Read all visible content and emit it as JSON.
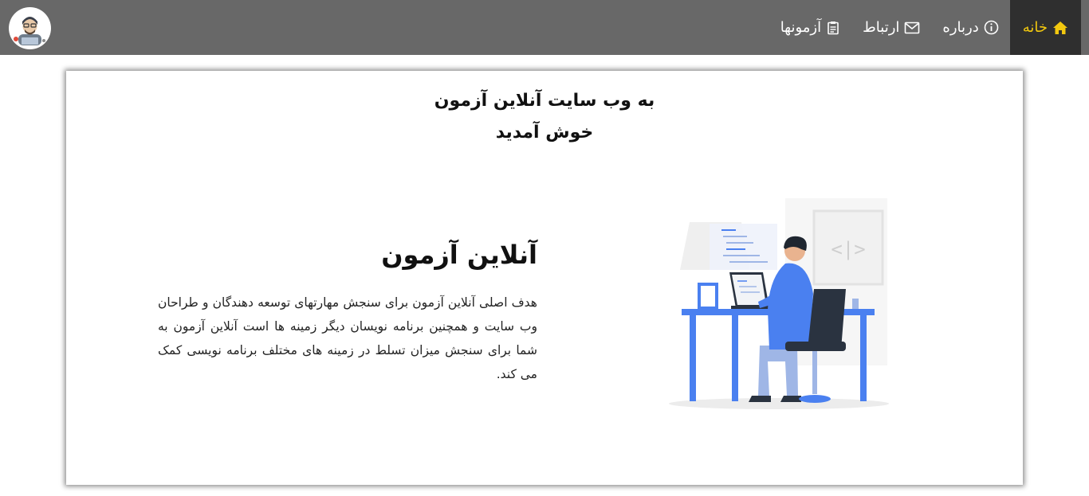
{
  "navbar": {
    "items": [
      {
        "label": "خانه",
        "icon": "home-icon",
        "active": true
      },
      {
        "label": "درباره",
        "icon": "info-icon",
        "active": false
      },
      {
        "label": "ارتباط",
        "icon": "mail-icon",
        "active": false
      },
      {
        "label": "آزمونها",
        "icon": "clipboard-icon",
        "active": false
      }
    ],
    "background": "#686868",
    "active_background": "#2f2f2f",
    "active_color": "#f2c80f",
    "logo": "developer-avatar"
  },
  "welcome": {
    "line1": "به وب سایت آنلاین آزمون",
    "line2": "خوش آمدید"
  },
  "intro": {
    "title": "آنلاین آزمون",
    "text": "هدف اصلی آنلاین آزمون برای سنجش مهارتهای توسعه دهندگان و طراحان وب سایت و همچنین برنامه نویسان دیگر زمینه ها است آنلاین آزمون به شما برای سنجش میزان تسلط در زمینه های مختلف برنامه نویسی کمک می کند."
  },
  "illustration": {
    "subject": "developer-at-desk-illustration",
    "code_tag": "<|>",
    "accent": "#4a80f0"
  }
}
